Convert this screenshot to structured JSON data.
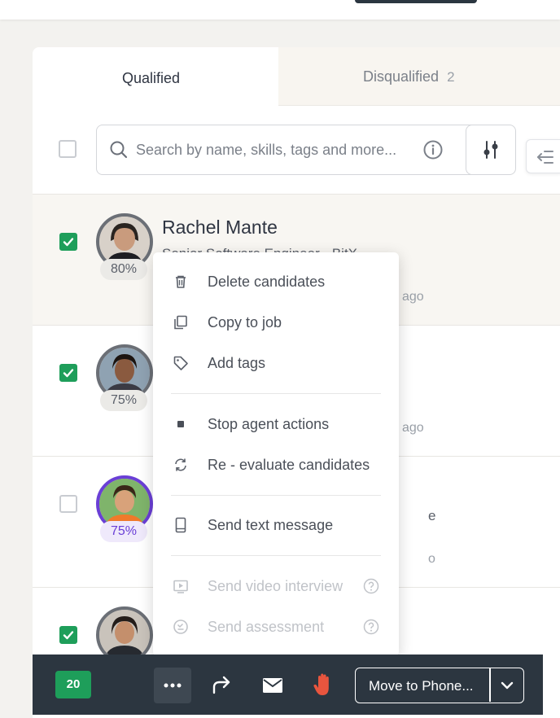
{
  "tabs": {
    "qualified": {
      "label": "Qualified"
    },
    "disqualified": {
      "label": "Disqualified",
      "count": "2"
    }
  },
  "search": {
    "placeholder": "Search by name, skills, tags and more..."
  },
  "candidates": [
    {
      "name": "Rachel Mante",
      "role": "Senior Software Engineer - BitX",
      "score": "80%",
      "ago": "ago",
      "checked": true
    },
    {
      "name": "",
      "role": "",
      "score": "75%",
      "ago": "ago",
      "checked": true
    },
    {
      "name": "",
      "role": "e",
      "score": "75%",
      "ago": "o",
      "checked": false
    },
    {
      "name": "",
      "role": "",
      "score": "",
      "ago": "",
      "checked": true
    }
  ],
  "menu": {
    "items": [
      {
        "label": "Delete candidates",
        "icon": "trash-icon"
      },
      {
        "label": "Copy to job",
        "icon": "copy-icon"
      },
      {
        "label": "Add tags",
        "icon": "tag-icon"
      },
      {
        "label": "Stop agent actions",
        "icon": "stop-icon"
      },
      {
        "label": "Re - evaluate candidates",
        "icon": "refresh-icon"
      },
      {
        "label": "Send text message",
        "icon": "phone-icon"
      },
      {
        "label": "Send video interview",
        "icon": "video-icon",
        "disabled": true
      },
      {
        "label": "Send assessment",
        "icon": "assessment-icon",
        "disabled": true
      }
    ]
  },
  "bottom_bar": {
    "selected_count": "20",
    "move_label": "Move to Phone..."
  },
  "colors": {
    "accent_green": "#1e9e5a",
    "accent_purple": "#6a3fd6",
    "bar_dark": "#2c3640",
    "hand_red": "#e8553e"
  }
}
